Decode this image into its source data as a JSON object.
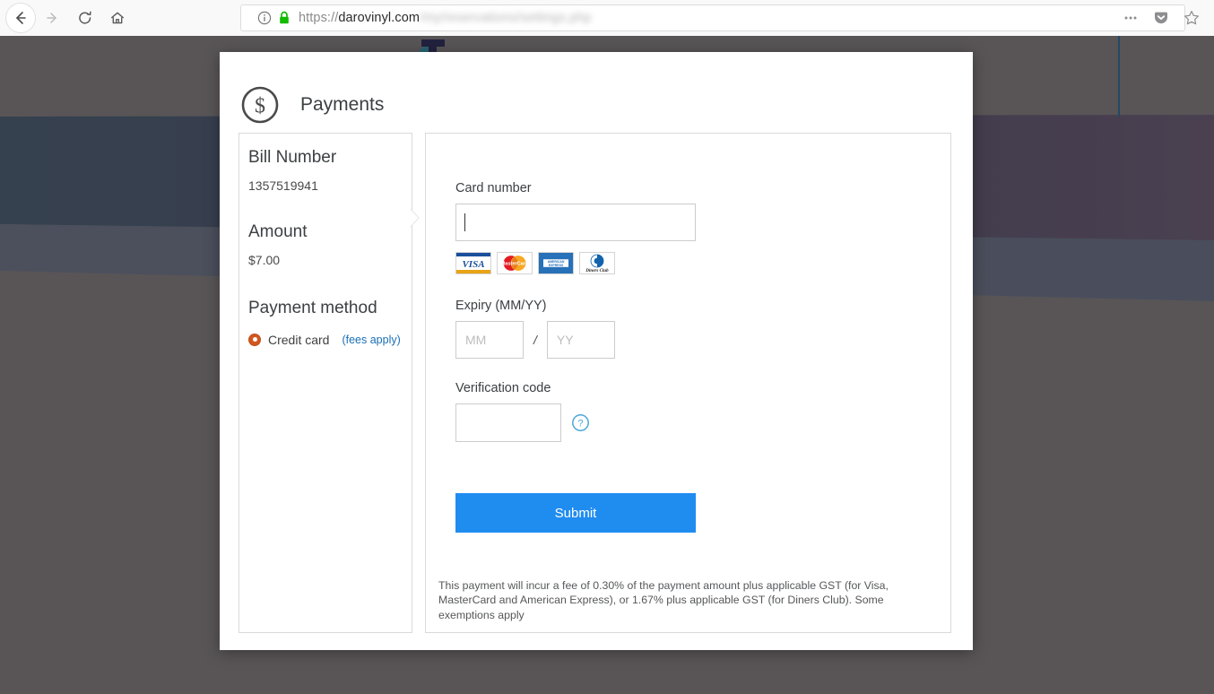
{
  "browser": {
    "nav": {
      "back_label": "Back",
      "forward_label": "Forward",
      "reload_label": "Reload",
      "home_label": "Home"
    },
    "url": {
      "scheme": "https://",
      "host": "darovinyl.com",
      "path_blurred": "/my/reservations/settings.php",
      "security_label": "Secure connection",
      "info_label": "Site information"
    },
    "toolbar_right": {
      "menu_label": "Open menu",
      "pocket_label": "Save to Pocket",
      "bookmark_label": "Bookmark this page"
    }
  },
  "modal": {
    "icon": "dollar-circle-icon",
    "title": "Payments",
    "summary": {
      "bill_number_label": "Bill Number",
      "bill_number_value": "1357519941",
      "amount_label": "Amount",
      "amount_value": "$7.00",
      "payment_method_label": "Payment method",
      "payment_method_option": "Credit card",
      "payment_method_fees": "(fees apply)",
      "payment_method_selected": true
    },
    "form": {
      "card_number_label": "Card number",
      "card_number_value": "",
      "card_number_placeholder": "",
      "accepted_cards": [
        "VISA",
        "MasterCard",
        "American Express",
        "Diners Club"
      ],
      "expiry_label": "Expiry (MM/YY)",
      "expiry_month_value": "",
      "expiry_month_placeholder": "MM",
      "expiry_separator": "/",
      "expiry_year_value": "",
      "expiry_year_placeholder": "YY",
      "verification_label": "Verification code",
      "verification_value": "",
      "verification_placeholder": "",
      "verification_help_icon": "question-mark-circle-icon",
      "submit_label": "Submit"
    },
    "disclaimer": "This payment will incur a fee of 0.30% of the payment amount plus applicable GST (for Visa, MasterCard and American Express), or 1.67% plus applicable GST (for Diners Club). Some exemptions apply"
  },
  "colors": {
    "accent_blue": "#1f8cf0",
    "link_blue": "#1a6fb5",
    "radio_orange": "#d2561f",
    "overlay": "#595557",
    "text_dark": "#3c4043"
  }
}
